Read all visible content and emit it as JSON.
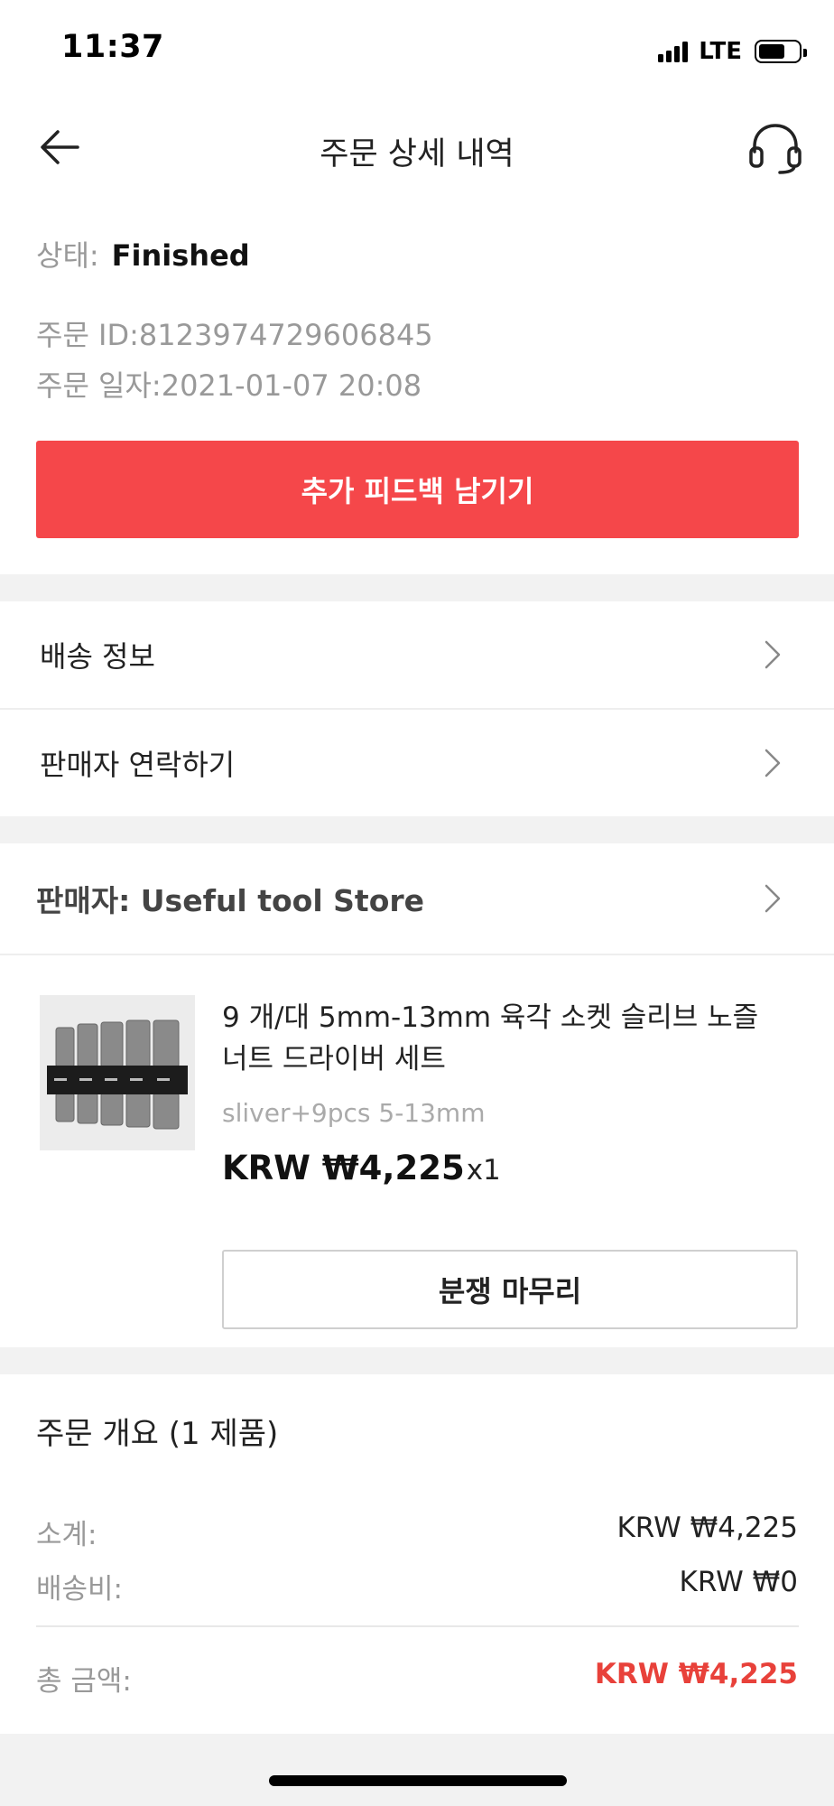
{
  "status_bar": {
    "time": "11:37",
    "network": "LTE"
  },
  "header": {
    "title": "주문 상세 내역",
    "back_icon": "arrow-left-icon",
    "support_icon": "headset-icon"
  },
  "order": {
    "status_label": "상태:",
    "status_value": "Finished",
    "order_id": "주문 ID:8123974729606845",
    "order_date": "주문 일자:2021-01-07 20:08",
    "feedback_button": "추가 피드백 남기기"
  },
  "menu": {
    "shipping_info": "배송 정보",
    "contact_seller": "판매자 연락하기"
  },
  "seller": {
    "label": "판매자: Useful tool Store"
  },
  "product": {
    "name": "9 개/대 5mm-13mm 육각 소켓 슬리브 노즐 너트 드라이버 세트",
    "variant": "sliver+9pcs 5-13mm",
    "price": "KRW ₩4,225",
    "quantity": "x1",
    "dispute_button": "분쟁 마무리"
  },
  "summary": {
    "title": "주문 개요 (1 제품)",
    "subtotal_label": "소계:",
    "subtotal_value": "KRW ₩4,225",
    "shipping_label": "배송비:",
    "shipping_value": "KRW ₩0",
    "total_label": "총 금액:",
    "total_value": "KRW ₩4,225"
  },
  "colors": {
    "accent": "#f5474a",
    "total": "#e8413a",
    "muted": "#999999"
  }
}
